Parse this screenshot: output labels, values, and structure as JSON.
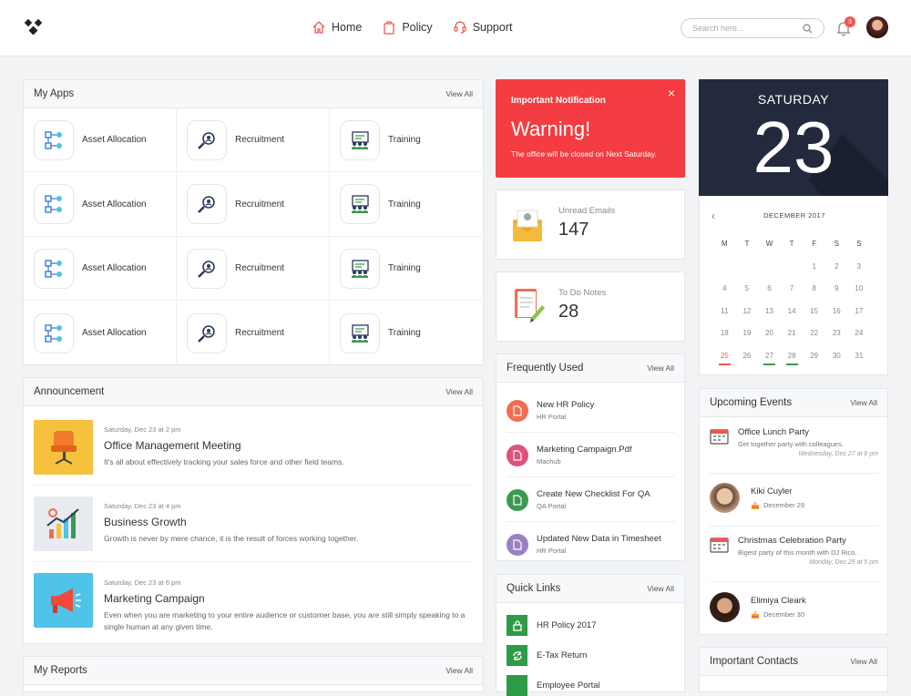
{
  "header": {
    "nav": [
      {
        "label": "Home",
        "icon": "home-icon"
      },
      {
        "label": "Policy",
        "icon": "policy-icon"
      },
      {
        "label": "Support",
        "icon": "support-icon"
      }
    ],
    "search_placeholder": "Search here...",
    "notification_count": "3"
  },
  "my_apps": {
    "title": "My Apps",
    "view_all": "View All",
    "rows": [
      [
        "Asset Allocation",
        "Recruitment",
        "Training"
      ],
      [
        "Asset Allocation",
        "Recruitment",
        "Training"
      ],
      [
        "Asset Allocation",
        "Recruitment",
        "Training"
      ],
      [
        "Asset Allocation",
        "Recruitment",
        "Training"
      ]
    ]
  },
  "announcement": {
    "title": "Announcement",
    "view_all": "View All",
    "items": [
      {
        "date": "Saturday, Dec 23 at 2 pm",
        "title": "Office Management Meeting",
        "desc": "It's all about effectively tracking your sales force and other field teams.",
        "thumb_color": "#f6c23e"
      },
      {
        "date": "Saturday, Dec 23 at 4 pm",
        "title": "Business Growth",
        "desc": "Growth is never by mere chance, it is the result of forces working together.",
        "thumb_color": "#e8ebef"
      },
      {
        "date": "Saturday, Dec 23 at 6 pm",
        "title": "Marketing Campaign",
        "desc": "Even when you are marketing to your entire audience or customer base, you are still simply speaking to a single human at any given time.",
        "thumb_color": "#4fc3e8"
      }
    ]
  },
  "my_reports": {
    "title": "My Reports",
    "view_all": "View All"
  },
  "notification": {
    "label": "Important Notification",
    "title": "Warning!",
    "message": "The office will be closed on Next Saturday.",
    "close": "×",
    "color": "#f43d42"
  },
  "unread_emails": {
    "label": "Unread Emails",
    "value": "147"
  },
  "todo_notes": {
    "label": "To Do Notes",
    "value": "28"
  },
  "frequently_used": {
    "title": "Frequently Used",
    "view_all": "View All",
    "items": [
      {
        "title": "New HR Policy",
        "sub": "HR Portal",
        "color": "#f26d4f"
      },
      {
        "title": "Marketing Campaign.Pdf",
        "sub": "Machub",
        "color": "#e0527a"
      },
      {
        "title": "Create New Checklist For QA",
        "sub": "QA Portal",
        "color": "#3a9a4e"
      },
      {
        "title": "Updated New Data in Timesheet",
        "sub": "HR Portal",
        "color": "#9b7fc4"
      }
    ]
  },
  "quick_links": {
    "title": "Quick Links",
    "view_all": "View All",
    "items": [
      {
        "label": "HR Policy 2017"
      },
      {
        "label": "E-Tax Return"
      },
      {
        "label": "Employee Portal"
      }
    ]
  },
  "calendar": {
    "weekday": "SATURDAY",
    "day": "23",
    "month": "DECEMBER 2017",
    "headers": [
      "M",
      "T",
      "W",
      "T",
      "F",
      "S",
      "S"
    ],
    "weeks": [
      [
        "",
        "",
        "",
        "",
        "1",
        "2",
        "3"
      ],
      [
        "4",
        "5",
        "6",
        "7",
        "8",
        "9",
        "10"
      ],
      [
        "11",
        "12",
        "13",
        "14",
        "15",
        "16",
        "17"
      ],
      [
        "18",
        "19",
        "20",
        "21",
        "22",
        "23",
        "24"
      ],
      [
        "25",
        "26",
        "27",
        "28",
        "29",
        "30",
        "31"
      ]
    ]
  },
  "upcoming_events": {
    "title": "Upcoming Events",
    "view_all": "View All",
    "items": [
      {
        "title": "Office Lunch Party",
        "sub": "Get together party with colleagues.",
        "time": "Wednesday, Dec 27 at 8 pm"
      },
      {
        "title": "Kiki Cuyler",
        "sub": "December 29"
      },
      {
        "title": "Christmas Celebration Party",
        "sub": "Bigest party of this month with DJ Rico.",
        "time": "Monday, Dec 25 at 5 pm"
      },
      {
        "title": "Elimiya Cleark",
        "sub": "December 30"
      }
    ]
  },
  "important_contacts": {
    "title": "Important Contacts",
    "view_all": "View All"
  }
}
